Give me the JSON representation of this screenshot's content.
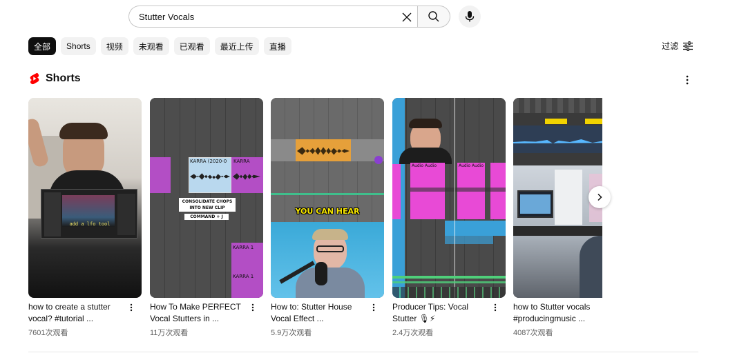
{
  "search": {
    "value": "Stutter Vocals"
  },
  "chips": [
    "全部",
    "Shorts",
    "视频",
    "未观看",
    "已观看",
    "最近上传",
    "直播"
  ],
  "filter": {
    "label": "过滤"
  },
  "shorts": {
    "title": "Shorts",
    "items": [
      {
        "title": "how to create a stutter vocal? #tutorial ...",
        "views": "7601次观看",
        "overlay_text": "add a lfo tool"
      },
      {
        "title": "How To Make PERFECT Vocal Stutters in ...",
        "views": "11万次观看",
        "overlay_text": [
          "KARRA (2020-0",
          "KARRA",
          "CONSOLIDATE CHOPS",
          "INTO NEW CLIP",
          "COMMAND + J",
          "KARRA 1",
          "KARRA 1"
        ]
      },
      {
        "title": "How to: Stutter House Vocal Effect ...",
        "views": "5.9万次观看",
        "overlay_text": "YOU CAN HEAR"
      },
      {
        "title": "Producer Tips: Vocal Stutter 🎙⚡",
        "views": "2.4万次观看",
        "overlay_text": [
          "Audio Audio",
          "Audio Audio"
        ]
      },
      {
        "title": "how to Stutter vocals #producingmusic ...",
        "views": "4087次观看",
        "overlay_text": ""
      }
    ]
  },
  "colors": {
    "brand_red": "#ff0000",
    "chip_active": "#0f0f0f",
    "chip_bg": "#f2f2f2"
  }
}
